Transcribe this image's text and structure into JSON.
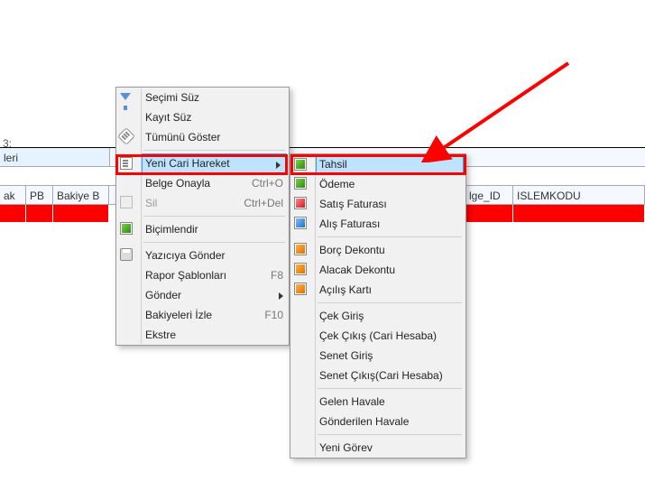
{
  "background": {
    "row1_tab": "leri",
    "small_text": "3;",
    "headers": [
      "ak",
      "PB",
      "Bakiye B",
      "lge_ID",
      "ISLEMKODU"
    ]
  },
  "context_menu": {
    "items": [
      {
        "label": "Seçimi Süz",
        "icon": "filter-icon"
      },
      {
        "label": "Kayıt Süz"
      },
      {
        "label": "Tümünü Göster",
        "icon": "showall-icon"
      },
      {
        "sep": true
      },
      {
        "label": "Yeni Cari Hareket",
        "highlight": true,
        "arrow": true,
        "icon": "doc-icon"
      },
      {
        "label": "Belge Onayla",
        "shortcut": "Ctrl+O"
      },
      {
        "label": "Sil",
        "shortcut": "Ctrl+Del",
        "disabled": true,
        "icon": "delete-icon"
      },
      {
        "sep": true
      },
      {
        "label": "Biçimlendir",
        "icon": "format-icon"
      },
      {
        "sep": true
      },
      {
        "label": "Yazıcıya Gönder",
        "icon": "print-icon"
      },
      {
        "label": "Rapor Şablonları",
        "shortcut": "F8"
      },
      {
        "label": "Gönder",
        "arrow": true
      },
      {
        "label": "Bakiyeleri İzle",
        "shortcut": "F10"
      },
      {
        "label": "Ekstre"
      }
    ]
  },
  "submenu": {
    "items": [
      {
        "label": "Tahsil",
        "highlight": true,
        "icon": "green-doc-icon"
      },
      {
        "label": "Ödeme",
        "icon": "green-doc-icon"
      },
      {
        "label": "Satış Faturası",
        "icon": "red-doc-icon"
      },
      {
        "label": "Alış Faturası",
        "icon": "blue-doc-icon"
      },
      {
        "sep": true
      },
      {
        "label": "Borç Dekontu",
        "icon": "orange-doc-icon"
      },
      {
        "label": "Alacak Dekontu",
        "icon": "orange-doc-icon"
      },
      {
        "label": "Açılış Kartı",
        "icon": "orange-doc-icon"
      },
      {
        "sep": true
      },
      {
        "label": "Çek Giriş"
      },
      {
        "label": "Çek Çıkış (Cari Hesaba)"
      },
      {
        "label": "Senet Giriş"
      },
      {
        "label": "Senet Çıkış(Cari Hesaba)"
      },
      {
        "sep": true
      },
      {
        "label": "Gelen Havale"
      },
      {
        "label": "Gönderilen Havale"
      },
      {
        "sep": true
      },
      {
        "label": "Yeni Görev"
      }
    ]
  }
}
